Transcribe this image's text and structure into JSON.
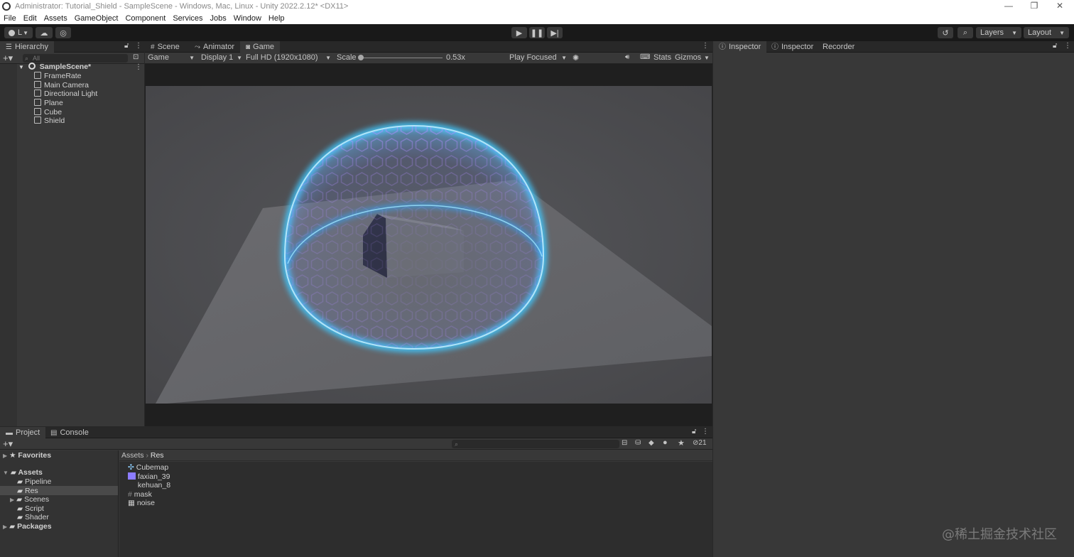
{
  "window": {
    "title": "Administrator: Tutorial_Shield - SampleScene - Windows, Mac, Linux - Unity 2022.2.12* <DX11>",
    "minimize": "—",
    "restore": "❐",
    "close": "✕"
  },
  "menu": [
    "File",
    "Edit",
    "Assets",
    "GameObject",
    "Component",
    "Services",
    "Jobs",
    "Window",
    "Help"
  ],
  "toolbar": {
    "account_label": "L",
    "layers_label": "Layers",
    "layout_label": "Layout"
  },
  "hierarchy": {
    "tab": "Hierarchy",
    "search_placeholder": "All",
    "scene": "SampleScene*",
    "items": [
      "FrameRate",
      "Main Camera",
      "Directional Light",
      "Plane",
      "Cube",
      "Shield"
    ]
  },
  "center_tabs": [
    "Scene",
    "Animator",
    "Game"
  ],
  "game_bar": {
    "mode": "Game",
    "display": "Display 1",
    "resolution": "Full HD (1920x1080)",
    "scale_label": "Scale",
    "scale_value": "0.53x",
    "play_mode": "Play Focused",
    "stats": "Stats",
    "gizmos": "Gizmos"
  },
  "right_tabs": [
    "Inspector",
    "Inspector",
    "Recorder"
  ],
  "bottom_tabs": [
    "Project",
    "Console"
  ],
  "project": {
    "favorites": "Favorites",
    "assets": "Assets",
    "asset_children": [
      "Pipeline",
      "Res",
      "Scenes",
      "Script",
      "Shader"
    ],
    "packages": "Packages",
    "breadcrumb": [
      "Assets",
      "Res"
    ],
    "files": [
      "Cubemap",
      "faxian_39",
      "kehuan_8",
      "mask",
      "noise"
    ],
    "hidden_count": "21"
  },
  "watermark": "@稀土掘金技术社区",
  "colors": {
    "shield_cyan": "#3fd0ff",
    "shield_violet": "#a070ff",
    "editor_bg": "#383838"
  }
}
